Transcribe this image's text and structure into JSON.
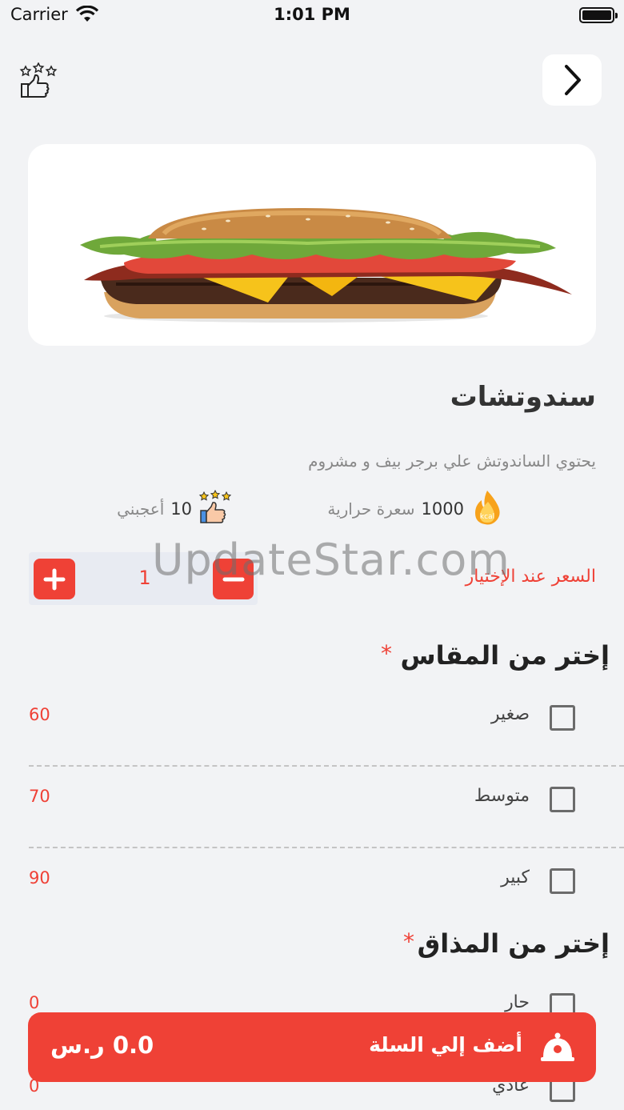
{
  "status_bar": {
    "carrier": "Carrier",
    "time": "1:01 PM"
  },
  "product": {
    "title": "سندوتشات",
    "description": "يحتوي الساندوتش علي برجر بيف و مشروم",
    "calories": {
      "value": "1000",
      "label": "سعرة حرارية",
      "badge": "kcal"
    },
    "likes": {
      "value": "10",
      "label": "أعجبني"
    },
    "price_note": "السعر عند الإختيار"
  },
  "quantity": {
    "value": "1"
  },
  "watermark": "UpdateStar.com",
  "size_section": {
    "title": "إختر من المقاس",
    "required": "*",
    "options": [
      {
        "name": "صغير",
        "price": "60"
      },
      {
        "name": "متوسط",
        "price": "70"
      },
      {
        "name": "كبير",
        "price": "90"
      }
    ]
  },
  "taste_section": {
    "title": "إختر من المذاق",
    "required": "*",
    "options": [
      {
        "name": "حار",
        "price": "0"
      },
      {
        "name": "عادي",
        "price": "0"
      }
    ]
  },
  "cart": {
    "label": "أضف إلي السلة",
    "total": "0.0 ر.س"
  },
  "colors": {
    "accent": "#ef4136",
    "background": "#f2f3f5"
  },
  "icons": [
    "wifi-icon",
    "battery-icon",
    "rate-like-icon",
    "back-chevron-icon",
    "calorie-flame-icon",
    "like-stars-icon",
    "plus-icon",
    "minus-icon",
    "checkbox-icon",
    "cart-dish-icon"
  ]
}
